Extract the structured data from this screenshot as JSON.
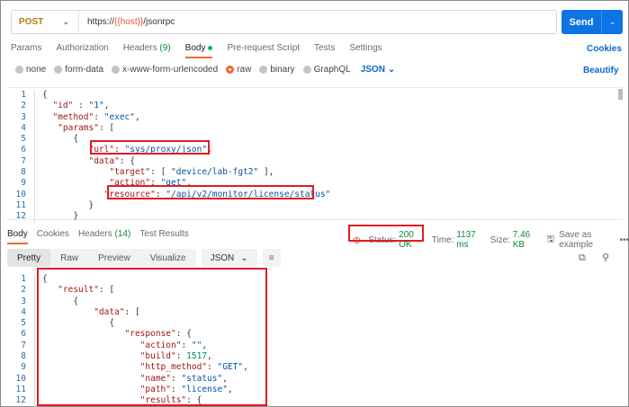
{
  "request": {
    "method": "POST",
    "url_prefix": "https://",
    "url_var": "{{host}}",
    "url_suffix": "/jsonrpc",
    "send_label": "Send"
  },
  "tabs": [
    {
      "label": "Params"
    },
    {
      "label": "Authorization"
    },
    {
      "label": "Headers",
      "count": "(9)"
    },
    {
      "label": "Body"
    },
    {
      "label": "Pre-request Script"
    },
    {
      "label": "Tests"
    },
    {
      "label": "Settings"
    }
  ],
  "cookies_label": "Cookies",
  "body_types": [
    "none",
    "form-data",
    "x-www-form-urlencoded",
    "raw",
    "binary",
    "GraphQL"
  ],
  "body_format": "JSON",
  "beautify_label": "Beautify",
  "request_body": [
    {
      "n": "1",
      "t": [
        [
          "p",
          "{"
        ]
      ]
    },
    {
      "n": "2",
      "t": [
        [
          "p",
          "  "
        ],
        [
          "k",
          "\"id\""
        ],
        [
          "p",
          " : "
        ],
        [
          "s",
          "\"1\""
        ],
        [
          "p",
          ","
        ]
      ]
    },
    {
      "n": "3",
      "t": [
        [
          "p",
          "  "
        ],
        [
          "k",
          "\"method\""
        ],
        [
          "p",
          ": "
        ],
        [
          "s",
          "\"exec\""
        ],
        [
          "p",
          ","
        ]
      ]
    },
    {
      "n": "4",
      "t": [
        [
          "p",
          "   "
        ],
        [
          "k",
          "\"params\""
        ],
        [
          "p",
          ": ["
        ]
      ]
    },
    {
      "n": "5",
      "t": [
        [
          "p",
          "      {"
        ]
      ]
    },
    {
      "n": "6",
      "t": [
        [
          "p",
          "         "
        ],
        [
          "k",
          "\"url\""
        ],
        [
          "p",
          ": "
        ],
        [
          "s",
          "\"sys/proxy/json\""
        ],
        [
          "p",
          ","
        ]
      ]
    },
    {
      "n": "7",
      "t": [
        [
          "p",
          "         "
        ],
        [
          "k",
          "\"data\""
        ],
        [
          "p",
          ": {"
        ]
      ]
    },
    {
      "n": "8",
      "t": [
        [
          "p",
          "             "
        ],
        [
          "k",
          "\"target\""
        ],
        [
          "p",
          ": [ "
        ],
        [
          "s",
          "\"device/lab-fgt2\""
        ],
        [
          "p",
          " ],"
        ]
      ]
    },
    {
      "n": "9",
      "t": [
        [
          "p",
          "             "
        ],
        [
          "k",
          "\"action\""
        ],
        [
          "p",
          ": "
        ],
        [
          "s",
          "\"get\""
        ],
        [
          "p",
          ","
        ]
      ]
    },
    {
      "n": "10",
      "t": [
        [
          "p",
          "            "
        ],
        [
          "k",
          "\"resource\""
        ],
        [
          "p",
          ": "
        ],
        [
          "s",
          "\"/api/v2/monitor/license/status\""
        ]
      ]
    },
    {
      "n": "11",
      "t": [
        [
          "p",
          "         }"
        ]
      ]
    },
    {
      "n": "12",
      "t": [
        [
          "p",
          "      }"
        ]
      ]
    }
  ],
  "response_tabs": [
    {
      "label": "Body"
    },
    {
      "label": "Cookies"
    },
    {
      "label": "Headers",
      "count": "(14)"
    },
    {
      "label": "Test Results"
    }
  ],
  "response_meta": {
    "status_label": "Status:",
    "status": "200 OK",
    "time_label": "Time:",
    "time": "1137 ms",
    "size_label": "Size:",
    "size": "7.46 KB",
    "save_label": "Save as example"
  },
  "view_modes": [
    "Pretty",
    "Raw",
    "Preview",
    "Visualize"
  ],
  "response_format": "JSON",
  "response_body": [
    {
      "n": "1",
      "t": [
        [
          "p",
          "{"
        ]
      ]
    },
    {
      "n": "2",
      "t": [
        [
          "p",
          "   "
        ],
        [
          "k",
          "\"result\""
        ],
        [
          "p",
          ": ["
        ]
      ]
    },
    {
      "n": "3",
      "t": [
        [
          "p",
          "      {"
        ]
      ]
    },
    {
      "n": "4",
      "t": [
        [
          "p",
          "          "
        ],
        [
          "k",
          "\"data\""
        ],
        [
          "p",
          ": ["
        ]
      ]
    },
    {
      "n": "5",
      "t": [
        [
          "p",
          "             {"
        ]
      ]
    },
    {
      "n": "6",
      "t": [
        [
          "p",
          "                "
        ],
        [
          "k",
          "\"response\""
        ],
        [
          "p",
          ": {"
        ]
      ]
    },
    {
      "n": "7",
      "t": [
        [
          "p",
          "                   "
        ],
        [
          "k",
          "\"action\""
        ],
        [
          "p",
          ": "
        ],
        [
          "s",
          "\"\""
        ],
        [
          "p",
          ","
        ]
      ]
    },
    {
      "n": "8",
      "t": [
        [
          "p",
          "                   "
        ],
        [
          "k",
          "\"build\""
        ],
        [
          "p",
          ": "
        ],
        [
          "n",
          "1517"
        ],
        [
          "p",
          ","
        ]
      ]
    },
    {
      "n": "9",
      "t": [
        [
          "p",
          "                   "
        ],
        [
          "k",
          "\"http_method\""
        ],
        [
          "p",
          ": "
        ],
        [
          "s",
          "\"GET\""
        ],
        [
          "p",
          ","
        ]
      ]
    },
    {
      "n": "10",
      "t": [
        [
          "p",
          "                   "
        ],
        [
          "k",
          "\"name\""
        ],
        [
          "p",
          ": "
        ],
        [
          "s",
          "\"status\""
        ],
        [
          "p",
          ","
        ]
      ]
    },
    {
      "n": "11",
      "t": [
        [
          "p",
          "                   "
        ],
        [
          "k",
          "\"path\""
        ],
        [
          "p",
          ": "
        ],
        [
          "s",
          "\"license\""
        ],
        [
          "p",
          ","
        ]
      ]
    },
    {
      "n": "12",
      "t": [
        [
          "p",
          "                   "
        ],
        [
          "k",
          "\"results\""
        ],
        [
          "p",
          ": {"
        ]
      ]
    }
  ],
  "colors": {
    "accent": "#f06733",
    "send": "#0c74e4",
    "highlight": "#e21b23",
    "status_ok": "#0a8a3a"
  }
}
